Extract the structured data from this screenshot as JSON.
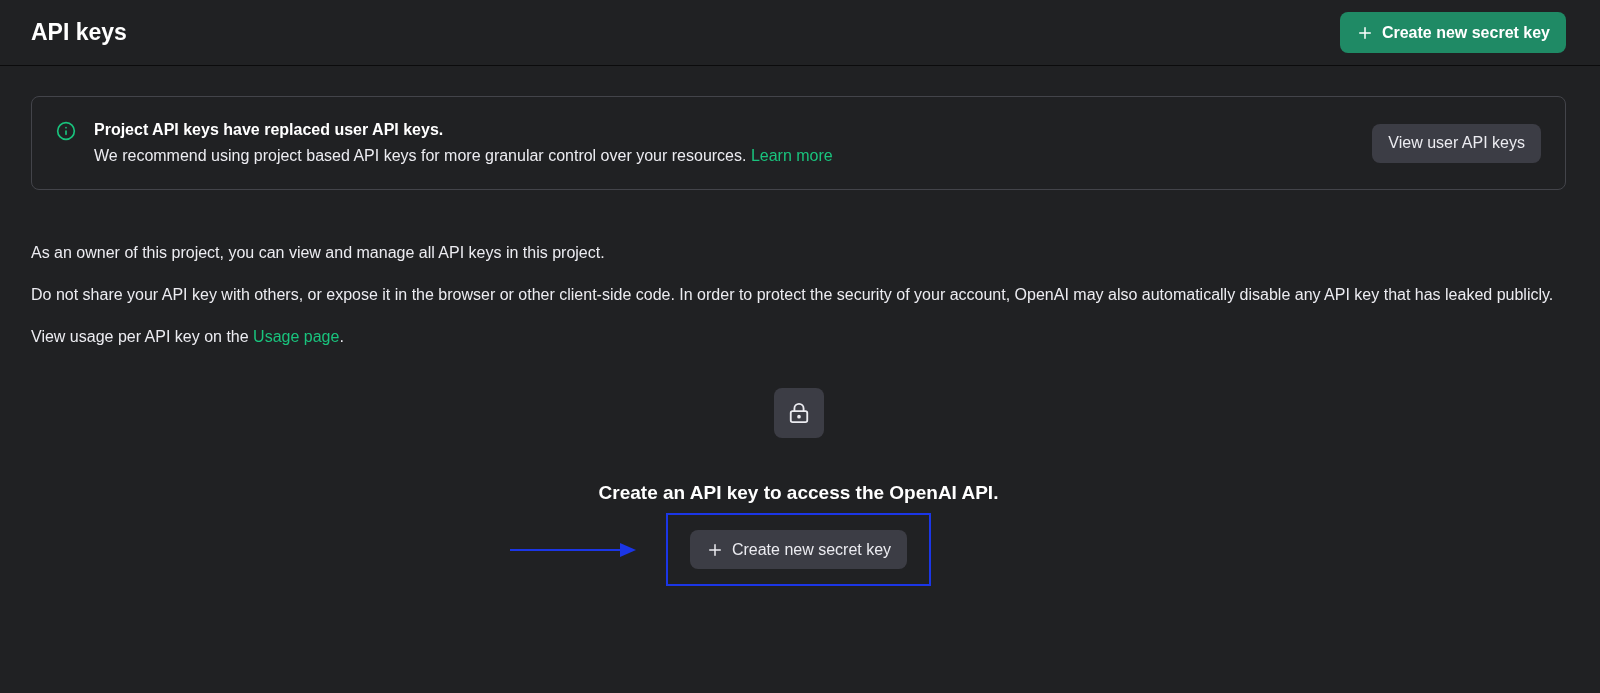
{
  "header": {
    "title": "API keys",
    "create_button": "Create new secret key"
  },
  "notice": {
    "title": "Project API keys have replaced user API keys.",
    "body": "We recommend using project based API keys for more granular control over your resources.",
    "link": "Learn more",
    "button": "View user API keys"
  },
  "paragraphs": [
    "As an owner of this project, you can view and manage all API keys in this project.",
    "Do not share your API key with others, or expose it in the browser or other client-side code. In order to protect the security of your account, OpenAI may also automatically disable any API key that has leaked publicly."
  ],
  "usage": {
    "text": "View usage per API key on the",
    "link": "Usage page",
    "suffix": "."
  },
  "empty_state": {
    "heading": "Create an API key to access the OpenAI API.",
    "button": "Create new secret key"
  }
}
